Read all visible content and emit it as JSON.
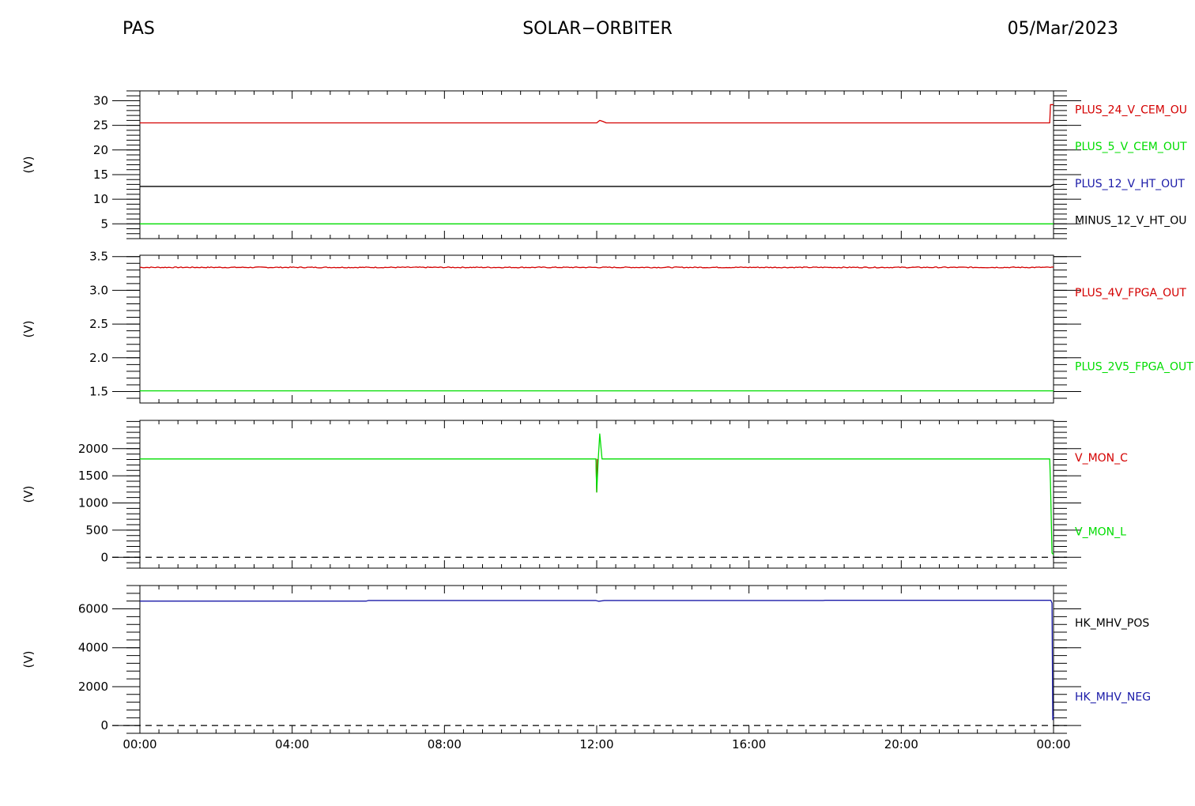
{
  "header": {
    "left": "PAS",
    "center": "SOLAR−ORBITER",
    "right": "05/Mar/2023"
  },
  "chart_data": [
    {
      "type": "line",
      "ylabel": "(V)",
      "ylim": [
        2,
        32
      ],
      "yticks": [
        5,
        10,
        15,
        20,
        25,
        30
      ],
      "yticklabels": [
        "5",
        "10",
        "15",
        "20",
        "25",
        "30"
      ],
      "yminor": 1,
      "xlim": [
        0,
        24
      ],
      "series": [
        {
          "name": "PLUS_24_V_CEM_OU",
          "color": "#d40000",
          "x": [
            0,
            12.0,
            12.08,
            12.16,
            12.25,
            23.9,
            23.92,
            24
          ],
          "y": [
            25.5,
            25.5,
            26.0,
            25.8,
            25.5,
            25.5,
            29.2,
            29.2
          ]
        },
        {
          "name": "PLUS_5_V_CEM_OUT",
          "color": "#00dd00",
          "x": [],
          "y": []
        },
        {
          "name": "PLUS_12_V_HT_OUT",
          "color": "#1a1aa8",
          "x": [],
          "y": []
        },
        {
          "name": "MINUS_12_V_HT_OU",
          "color": "#000000",
          "x": [
            0,
            23.92,
            24
          ],
          "y": [
            12.6,
            12.6,
            13.0
          ]
        },
        {
          "name": "",
          "color": "#00dd00",
          "x": [
            0,
            24
          ],
          "y": [
            5.0,
            5.0
          ]
        }
      ],
      "legend": [
        "PLUS_24_V_CEM_OU",
        "PLUS_5_V_CEM_OUT",
        "PLUS_12_V_HT_OUT",
        "MINUS_12_V_HT_OU"
      ]
    },
    {
      "type": "line",
      "ylabel": "(V)",
      "ylim": [
        1.33,
        3.52
      ],
      "yticks": [
        1.5,
        2.0,
        2.5,
        3.0,
        3.5
      ],
      "yticklabels": [
        "1.5",
        "2.0",
        "2.5",
        "3.0",
        "3.5"
      ],
      "yminor": 0.1,
      "xlim": [
        0,
        24
      ],
      "series": [
        {
          "name": "PLUS_4V_FPGA_OUT",
          "color": "#d40000",
          "x": [
            0,
            24
          ],
          "y": [
            3.34,
            3.34
          ],
          "noise": 0.007
        },
        {
          "name": "PLUS_2V5_FPGA_OUT",
          "color": "#00dd00",
          "x": [
            0,
            24
          ],
          "y": [
            1.51,
            1.51
          ]
        }
      ],
      "legend": [
        "PLUS_4V_FPGA_OUT",
        "PLUS_2V5_FPGA_OUT"
      ]
    },
    {
      "type": "line",
      "ylabel": "(V)",
      "ylim": [
        -200,
        2520
      ],
      "yticks": [
        0,
        500,
        1000,
        1500,
        2000
      ],
      "yticklabels": [
        "0",
        "500",
        "1000",
        "1500",
        "2000"
      ],
      "yminor": 100,
      "zero_dashed": true,
      "xlim": [
        0,
        24
      ],
      "series": [
        {
          "name": "V_MON_C",
          "color": "#d40000",
          "x": [
            11.98,
            12.0,
            12.02
          ],
          "y": [
            1810,
            1200,
            1810
          ]
        },
        {
          "name": "V_MON_L",
          "color": "#00dd00",
          "x": [
            0,
            11.98,
            12.0,
            12.04,
            12.08,
            12.14,
            12.2,
            23.9,
            23.92,
            23.96,
            24
          ],
          "y": [
            1810,
            1810,
            1200,
            1800,
            2270,
            1810,
            1810,
            1810,
            1360,
            80,
            50
          ]
        }
      ],
      "legend": [
        "V_MON_C",
        "V_MON_L"
      ]
    },
    {
      "type": "line",
      "ylabel": "(V)",
      "ylim": [
        -400,
        7200
      ],
      "yticks": [
        0,
        2000,
        4000,
        6000
      ],
      "yticklabels": [
        "0",
        "2000",
        "4000",
        "6000"
      ],
      "yminor": 400,
      "zero_dashed": true,
      "xlim": [
        0,
        24
      ],
      "series": [
        {
          "name": "HK_MHV_POS",
          "color": "#000000",
          "x": [],
          "y": []
        },
        {
          "name": "HK_MHV_NEG",
          "color": "#1a1aa8",
          "x": [
            0,
            5.95,
            6.0,
            11.98,
            12.05,
            12.2,
            17.95,
            18.0,
            23.93,
            23.96,
            23.98,
            24
          ],
          "y": [
            6400,
            6400,
            6430,
            6430,
            6390,
            6430,
            6430,
            6440,
            6440,
            6300,
            300,
            500
          ]
        }
      ],
      "legend": [
        "HK_MHV_POS",
        "HK_MHV_NEG"
      ]
    }
  ],
  "xaxis": {
    "ticks": [
      0,
      4,
      8,
      12,
      16,
      20,
      24
    ],
    "labels": [
      "00:00",
      "04:00",
      "08:00",
      "12:00",
      "16:00",
      "20:00",
      "00:00"
    ],
    "minor": 0.5
  }
}
